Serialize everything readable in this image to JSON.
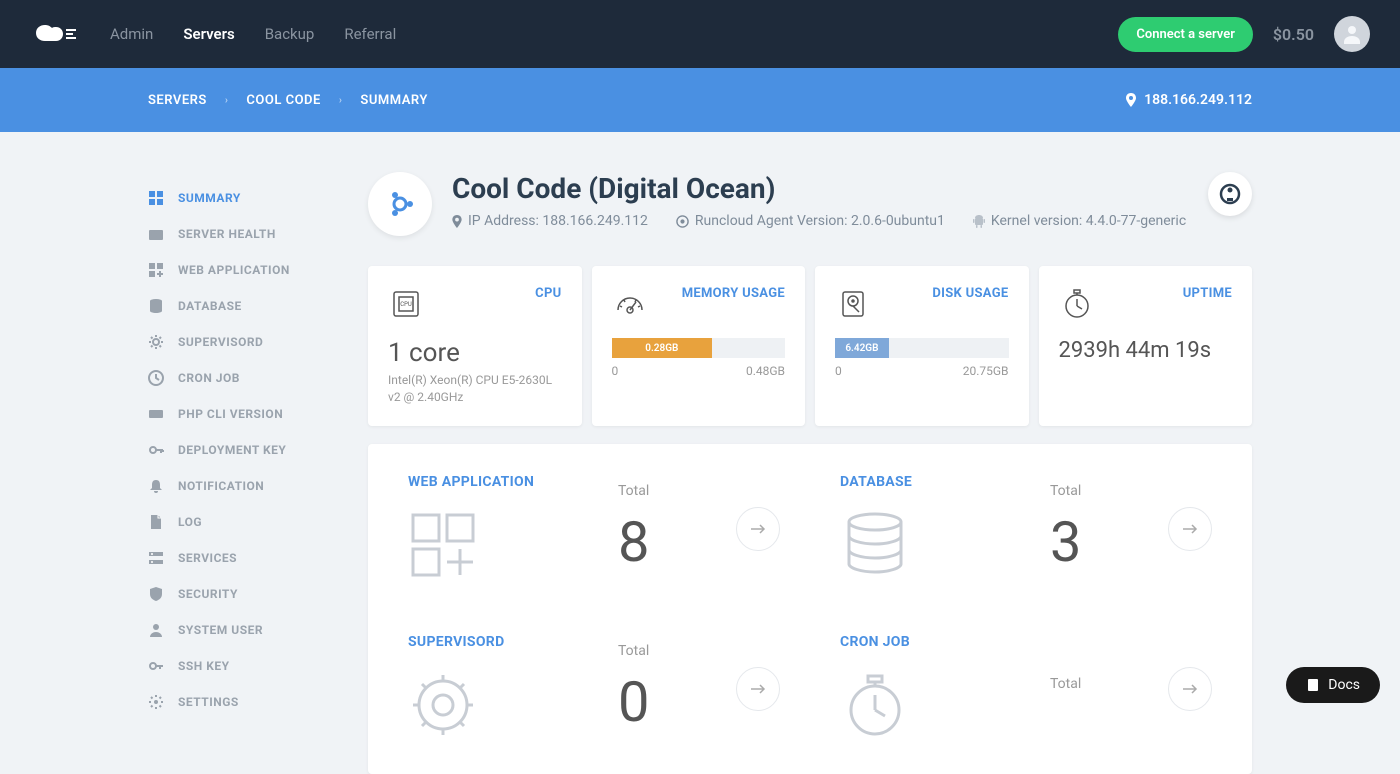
{
  "topbar": {
    "nav": [
      "Admin",
      "Servers",
      "Backup",
      "Referral"
    ],
    "activeNav": "Servers",
    "connect": "Connect a server",
    "balance": "$0.50"
  },
  "breadcrumb": {
    "items": [
      "SERVERS",
      "COOL CODE",
      "SUMMARY"
    ],
    "ip": "188.166.249.112"
  },
  "sidebar": {
    "items": [
      {
        "label": "SUMMARY",
        "icon": "grid",
        "active": true
      },
      {
        "label": "SERVER HEALTH",
        "icon": "health"
      },
      {
        "label": "WEB APPLICATION",
        "icon": "webapp"
      },
      {
        "label": "DATABASE",
        "icon": "db"
      },
      {
        "label": "SUPERVISORD",
        "icon": "gear"
      },
      {
        "label": "CRON JOB",
        "icon": "clock"
      },
      {
        "label": "PHP CLI VERSION",
        "icon": "php"
      },
      {
        "label": "DEPLOYMENT KEY",
        "icon": "key"
      },
      {
        "label": "NOTIFICATION",
        "icon": "bell"
      },
      {
        "label": "LOG",
        "icon": "file"
      },
      {
        "label": "SERVICES",
        "icon": "services"
      },
      {
        "label": "SECURITY",
        "icon": "shield"
      },
      {
        "label": "SYSTEM USER",
        "icon": "user"
      },
      {
        "label": "SSH KEY",
        "icon": "sshkey"
      },
      {
        "label": "SETTINGS",
        "icon": "cog"
      }
    ]
  },
  "server": {
    "title": "Cool Code (Digital Ocean)",
    "ipLabel": "IP Address: 188.166.249.112",
    "agentLabel": "Runcloud Agent Version: 2.0.6-0ubuntu1",
    "kernelLabel": "Kernel version: 4.4.0-77-generic"
  },
  "stats": {
    "cpu": {
      "label": "CPU",
      "cores": "1 core",
      "desc": "Intel(R) Xeon(R) CPU E5-2630L v2 @ 2.40GHz"
    },
    "memory": {
      "label": "MEMORY USAGE",
      "used": "0.28GB",
      "min": "0",
      "max": "0.48GB"
    },
    "disk": {
      "label": "DISK USAGE",
      "used": "6.42GB",
      "min": "0",
      "max": "20.75GB"
    },
    "uptime": {
      "label": "UPTIME",
      "value": "2939h 44m 19s"
    }
  },
  "summary": {
    "totalLabel": "Total",
    "cells": [
      {
        "title": "WEB APPLICATION",
        "count": "8",
        "icon": "webapp"
      },
      {
        "title": "DATABASE",
        "count": "3",
        "icon": "db"
      },
      {
        "title": "SUPERVISORD",
        "count": "0",
        "icon": "gear"
      },
      {
        "title": "CRON JOB",
        "count": "",
        "icon": "clock"
      }
    ]
  },
  "docs": "Docs"
}
